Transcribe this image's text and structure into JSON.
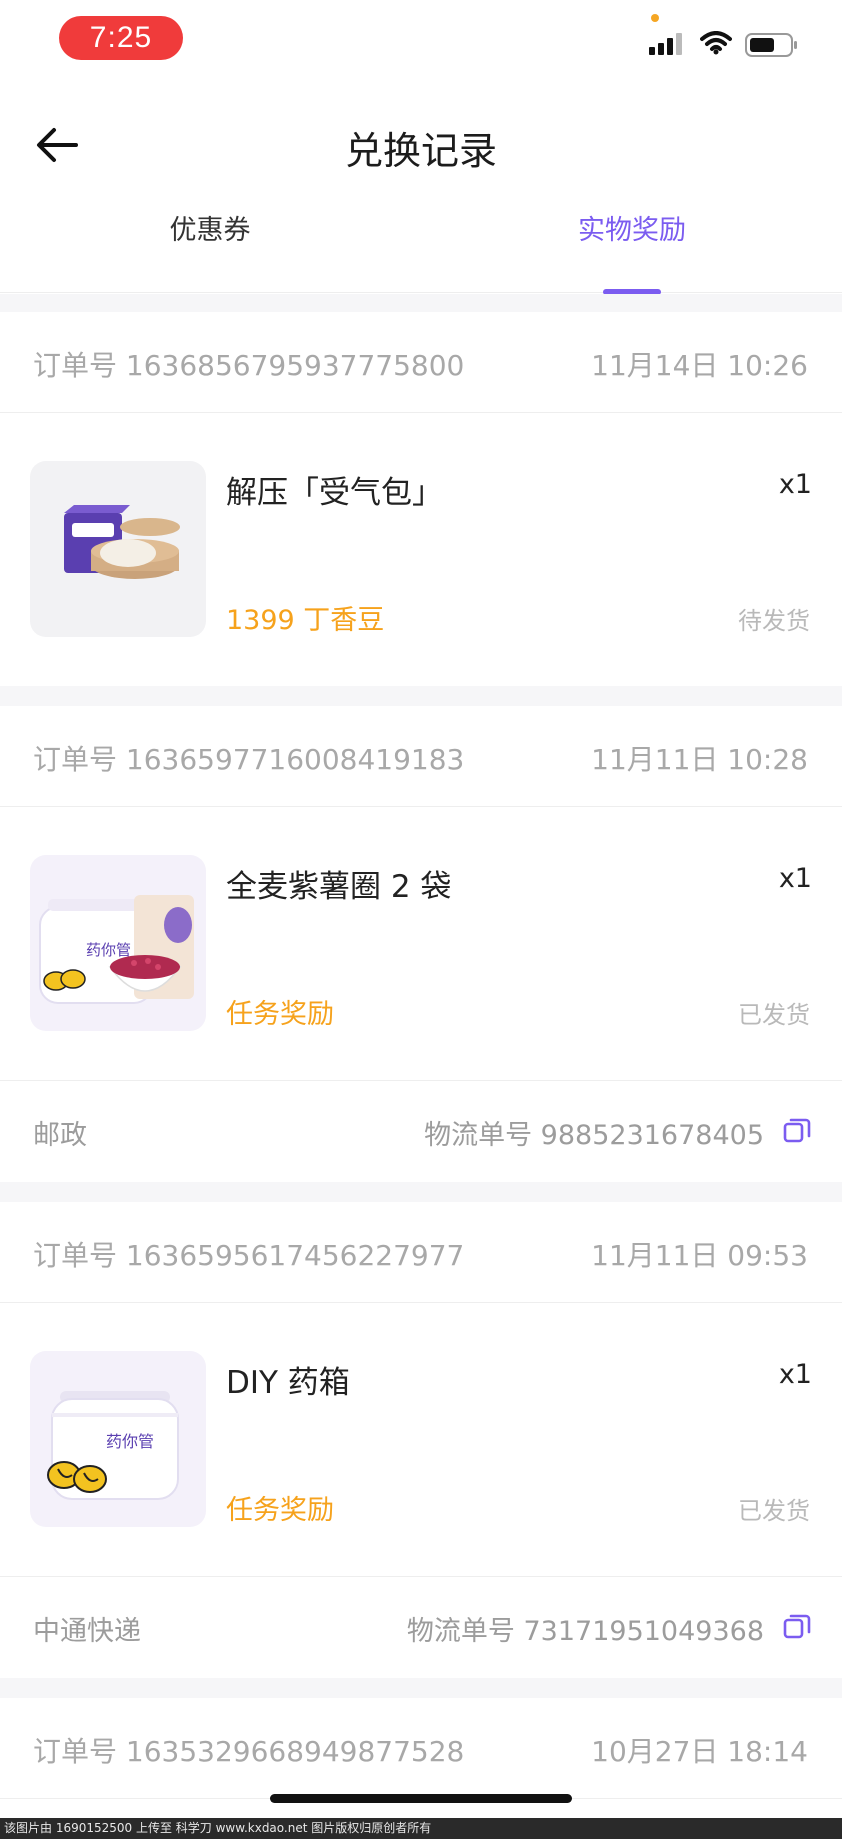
{
  "status_bar": {
    "time": "7:25"
  },
  "nav": {
    "title": "兑换记录"
  },
  "tabs": [
    {
      "label": "优惠券",
      "active": false
    },
    {
      "label": "实物奖励",
      "active": true
    }
  ],
  "colors": {
    "accent": "#7b5cf0",
    "price": "#f6a21c",
    "time_pill": "#f03b3b"
  },
  "orders": [
    {
      "order_no": "订单号 1636856795937775800",
      "date": "11月14日 10:26",
      "product_name": "解压「受气包」",
      "qty": "x1",
      "price": "1399 丁香豆",
      "status": "待发货",
      "image": "stress-bun-box"
    },
    {
      "order_no": "订单号 1636597716008419183",
      "date": "11月11日 10:28",
      "product_name": "全麦紫薯圈 2 袋",
      "qty": "x1",
      "price": "任务奖励",
      "status": "已发货",
      "carrier": "邮政",
      "tracking": "物流单号 9885231678405",
      "image": "purple-potato-rings"
    },
    {
      "order_no": "订单号 1636595617456227977",
      "date": "11月11日 09:53",
      "product_name": "DIY 药箱",
      "qty": "x1",
      "price": "任务奖励",
      "status": "已发货",
      "carrier": "中通快递",
      "tracking": "物流单号 73171951049368",
      "image": "medicine-box"
    },
    {
      "order_no": "订单号 1635329668949877528",
      "date": "10月27日 18:14"
    }
  ],
  "box_label": "药你管",
  "watermark": "该图片由 1690152500 上传至 科学刀 www.kxdao.net 图片版权归原创者所有"
}
